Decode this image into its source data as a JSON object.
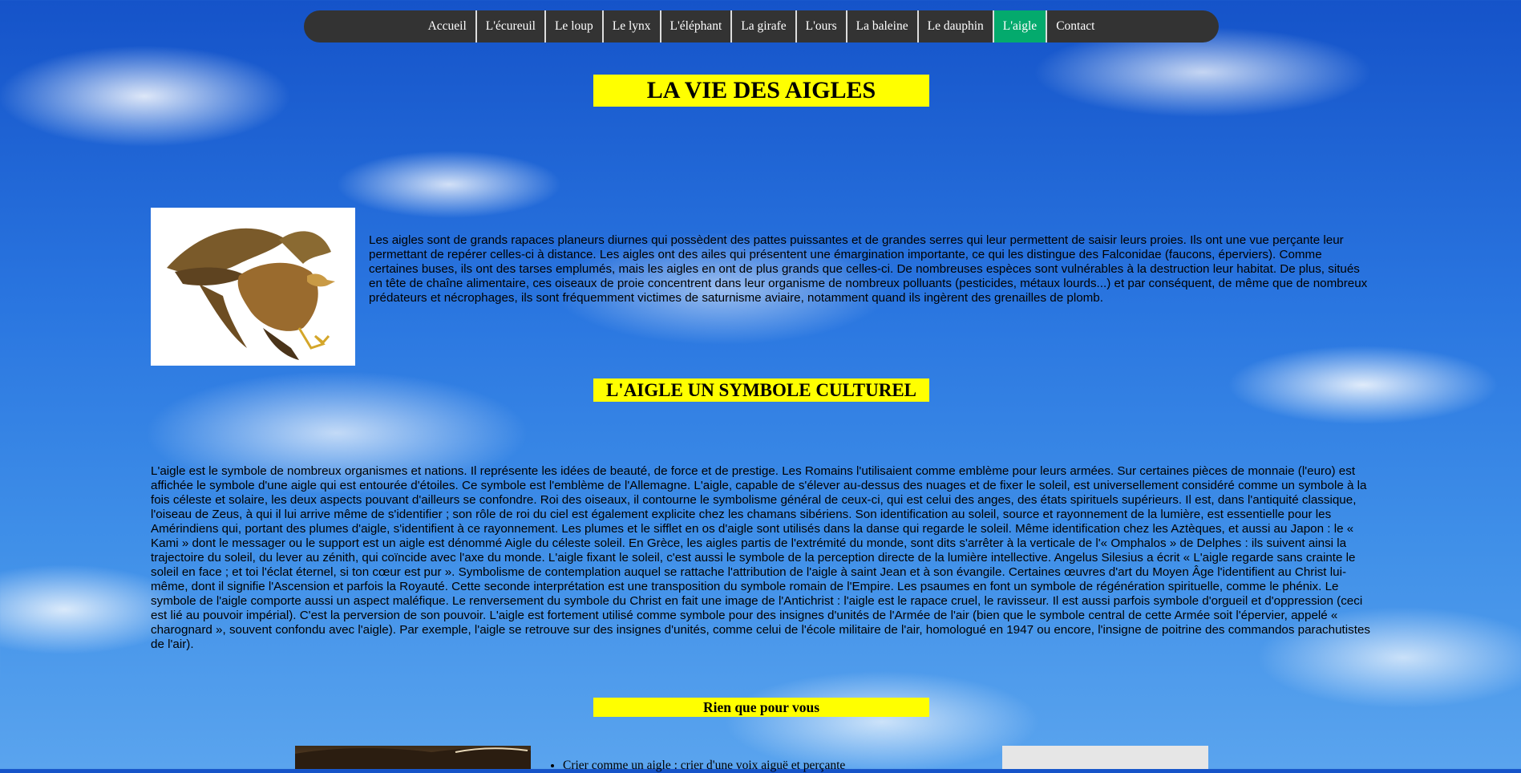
{
  "nav": {
    "items": [
      "Accueil",
      "L'écureuil",
      "Le loup",
      "Le lynx",
      "L'éléphant",
      "La girafe",
      "L'ours",
      "La baleine",
      "Le dauphin",
      "L'aigle",
      "Contact"
    ],
    "active_index": 9,
    "active_color": "#04aa6d",
    "bar_color": "#333333"
  },
  "title": "LA VIE DES AIGLES",
  "intro": "Les aigles sont de grands rapaces planeurs diurnes qui possèdent des pattes puissantes et de grandes serres qui leur permettent de saisir leurs proies. Ils ont une vue perçante leur permettant de repérer celles-ci à distance. Les aigles ont des ailes qui présentent une émargination importante, ce qui les distingue des Falconidae (faucons, éperviers). Comme certaines buses, ils ont des tarses emplumés, mais les aigles en ont de plus grands que celles-ci. De nombreuses espèces sont vulnérables à la destruction leur habitat. De plus, situés en tête de chaîne alimentaire, ces oiseaux de proie concentrent dans leur organisme de nombreux polluants (pesticides, métaux lourds...) et par conséquent, de même que de nombreux prédateurs et nécrophages, ils sont fréquemment victimes de saturnisme aviaire, notamment quand ils ingèrent des grenailles de plomb.",
  "section2_title": "L'AIGLE UN SYMBOLE CULTUREL",
  "section2_text": "L'aigle est le symbole de nombreux organismes et nations. Il représente les idées de beauté, de force et de prestige. Les Romains l'utilisaient comme emblème pour leurs armées. Sur certaines pièces de monnaie (l'euro) est affichée le symbole d'une aigle qui est entourée d'étoiles. Ce symbole est l'emblème de l'Allemagne. L'aigle, capable de s'élever au-dessus des nuages et de fixer le soleil, est universellement considéré comme un symbole à la fois céleste et solaire, les deux aspects pouvant d'ailleurs se confondre. Roi des oiseaux, il contourne le symbolisme général de ceux-ci, qui est celui des anges, des états spirituels supérieurs. Il est, dans l'antiquité classique, l'oiseau de Zeus, à qui il lui arrive même de s'identifier ; son rôle de roi du ciel est également explicite chez les chamans sibériens. Son identification au soleil, source et rayonnement de la lumière, est essentielle pour les Amérindiens qui, portant des plumes d'aigle, s'identifient à ce rayonnement. Les plumes et le sifflet en os d'aigle sont utilisés dans la danse qui regarde le soleil. Même identification chez les Aztèques, et aussi au Japon : le « Kami » dont le messager ou le support est un aigle est dénommé Aigle du céleste soleil. En Grèce, les aigles partis de l'extrémité du monde, sont dits s'arrêter à la verticale de l'« Omphalos » de Delphes : ils suivent ainsi la trajectoire du soleil, du lever au zénith, qui coïncide avec l'axe du monde. L'aigle fixant le soleil, c'est aussi le symbole de la perception directe de la lumière intellective. Angelus Silesius a écrit « L'aigle regarde sans crainte le soleil en face ; et toi l'éclat éternel, si ton cœur est pur ». Symbolisme de contemplation auquel se rattache l'attribution de l'aigle à saint Jean et à son évangile. Certaines œuvres d'art du Moyen Âge l'identifient au Christ lui-même, dont il signifie l'Ascension et parfois la Royauté. Cette seconde interprétation est une transposition du symbole romain de l'Empire. Les psaumes en font un symbole de régénération spirituelle, comme le phénix. Le symbole de l'aigle comporte aussi un aspect maléfique. Le renversement du symbole du Christ en fait une image de l'Antichrist : l'aigle est le rapace cruel, le ravisseur. Il est aussi parfois symbole d'orgueil et d'oppression (ceci est lié au pouvoir impérial). C'est la perversion de son pouvoir. L'aigle est fortement utilisé comme symbole pour des insignes d'unités de l'Armée de l'air (bien que le symbole central de cette Armée soit l'épervier, appelé « charognard », souvent confondu avec l'aigle). Par exemple, l'aigle se retrouve sur des insignes d'unités, comme celui de l'école militaire de l'air, homologué en 1947 ou encore, l'insigne de poitrine des commandos parachutistes de l'air).",
  "section3_title": "Rien que pour vous",
  "list_items": [
    "Crier comme un aigle : crier d'une voix aiguë et perçante"
  ],
  "banner_color": "#ffff00"
}
